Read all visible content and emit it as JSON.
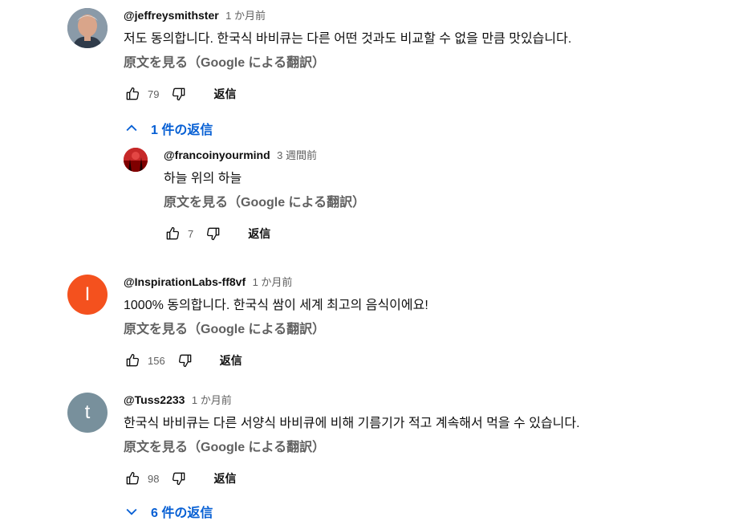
{
  "comments": [
    {
      "author": "@jeffreysmithster",
      "time": "1 か月前",
      "text": "저도 동의합니다. 한국식 바비큐는 다른 어떤 것과도 비교할 수 없을 만큼 맛있습니다.",
      "translate": "原文を見る（Google による翻訳）",
      "likes": "79",
      "reply_label": "返信",
      "replies_toggle": "1 件の返信"
    },
    {
      "author": "@InspirationLabs-ff8vf",
      "time": "1 か月前",
      "avatar_letter": "I",
      "avatar_color": "#f4511e",
      "text": "1000% 동의합니다. 한국식 쌈이 세계 최고의 음식이에요!",
      "translate": "原文を見る（Google による翻訳）",
      "likes": "156",
      "reply_label": "返信"
    },
    {
      "author": "@Tuss2233",
      "time": "1 か月前",
      "avatar_letter": "t",
      "avatar_color": "#78909c",
      "text": "한국식 바비큐는 다른 서양식 바비큐에 비해 기름기가 적고 계속해서 먹을 수 있습니다.",
      "translate": "原文を見る（Google による翻訳）",
      "likes": "98",
      "reply_label": "返信",
      "replies_toggle": "6 件の返信"
    }
  ],
  "reply": {
    "author": "@francoinyourmind",
    "time": "3 週間前",
    "text": "하늘 위의 하늘",
    "translate": "原文を見る（Google による翻訳）",
    "likes": "7",
    "reply_label": "返信"
  },
  "colors": {
    "link_blue": "#065fd4",
    "secondary_text": "#606060"
  },
  "icons": {
    "like": "thumb-up-icon",
    "dislike": "thumb-down-icon",
    "collapse": "chevron-up-icon",
    "expand": "chevron-down-icon"
  }
}
